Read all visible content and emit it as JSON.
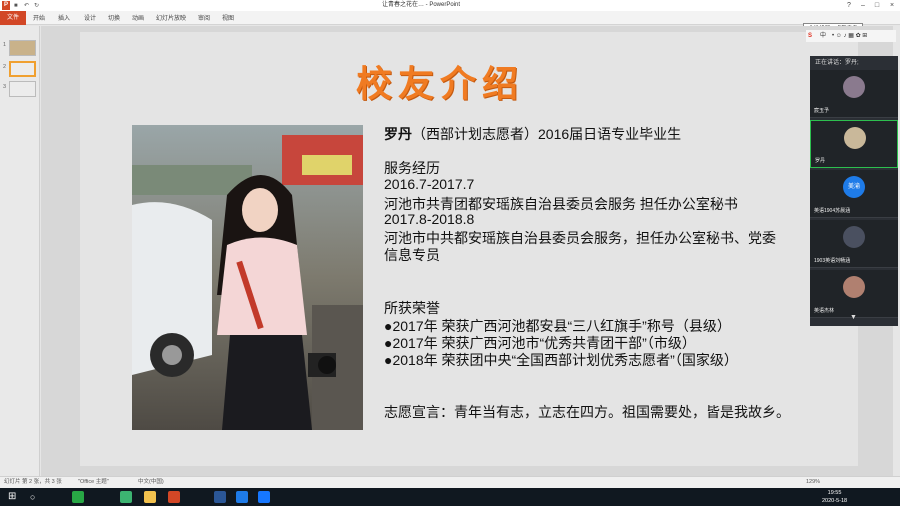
{
  "window": {
    "title": "让青春之花在… - PowerPoint"
  },
  "ribbon": {
    "tabs": [
      "开始",
      "插入",
      "设计",
      "切换",
      "动画",
      "幻灯片放映",
      "审阅",
      "视图"
    ],
    "file_tab": "文件",
    "tooltip": "个性设置，点我看看"
  },
  "thumbnails": [
    "1",
    "2",
    "3"
  ],
  "ime": {
    "label": "中"
  },
  "slide": {
    "title": "校友介绍",
    "name": "罗丹",
    "intro_rest": "（西部计划志愿者）2016届日语专业毕业生",
    "lines": [
      "服务经历",
      "2016.7-2017.7",
      "河池市共青团都安瑶族自治县委员会服务 担任办公室秘书",
      "2017.8-2018.8",
      "河池市中共都安瑶族自治县委员会服务，担任办公室秘书、党委",
      "信息专员",
      "所获荣誉",
      "●2017年 荣获广西河池都安县“三八红旗手”称号（县级）",
      "●2017年 荣获广西河池市“优秀共青团干部”（市级）",
      "●2018年 荣获团中央“全国西部计划优秀志愿者”（国家级）",
      "志愿宣言：青年当有志，立志在四方。祖国需要处，皆是我故乡。"
    ]
  },
  "meeting": {
    "header": "正在讲话：罗丹;",
    "participants": [
      {
        "name": "宸玉予",
        "color": "#8a7a8e"
      },
      {
        "name": "罗丹",
        "color": "#c9b89a"
      },
      {
        "name": "英语1904苏晨涵",
        "avatar_text": "美渝",
        "color": "#1e7be8"
      },
      {
        "name": "1903英语刘畅涵",
        "color": "#4a5060"
      },
      {
        "name": "英语杰林",
        "color": "#b08070"
      }
    ]
  },
  "statusbar": {
    "slide_info": "幻灯片 第 2 张，共 3 张",
    "theme": "\"Office 主题\"",
    "lang": "中文(中国)",
    "zoom": "129%"
  },
  "taskbar": {
    "time": "19:55",
    "date": "2020-5-18"
  }
}
